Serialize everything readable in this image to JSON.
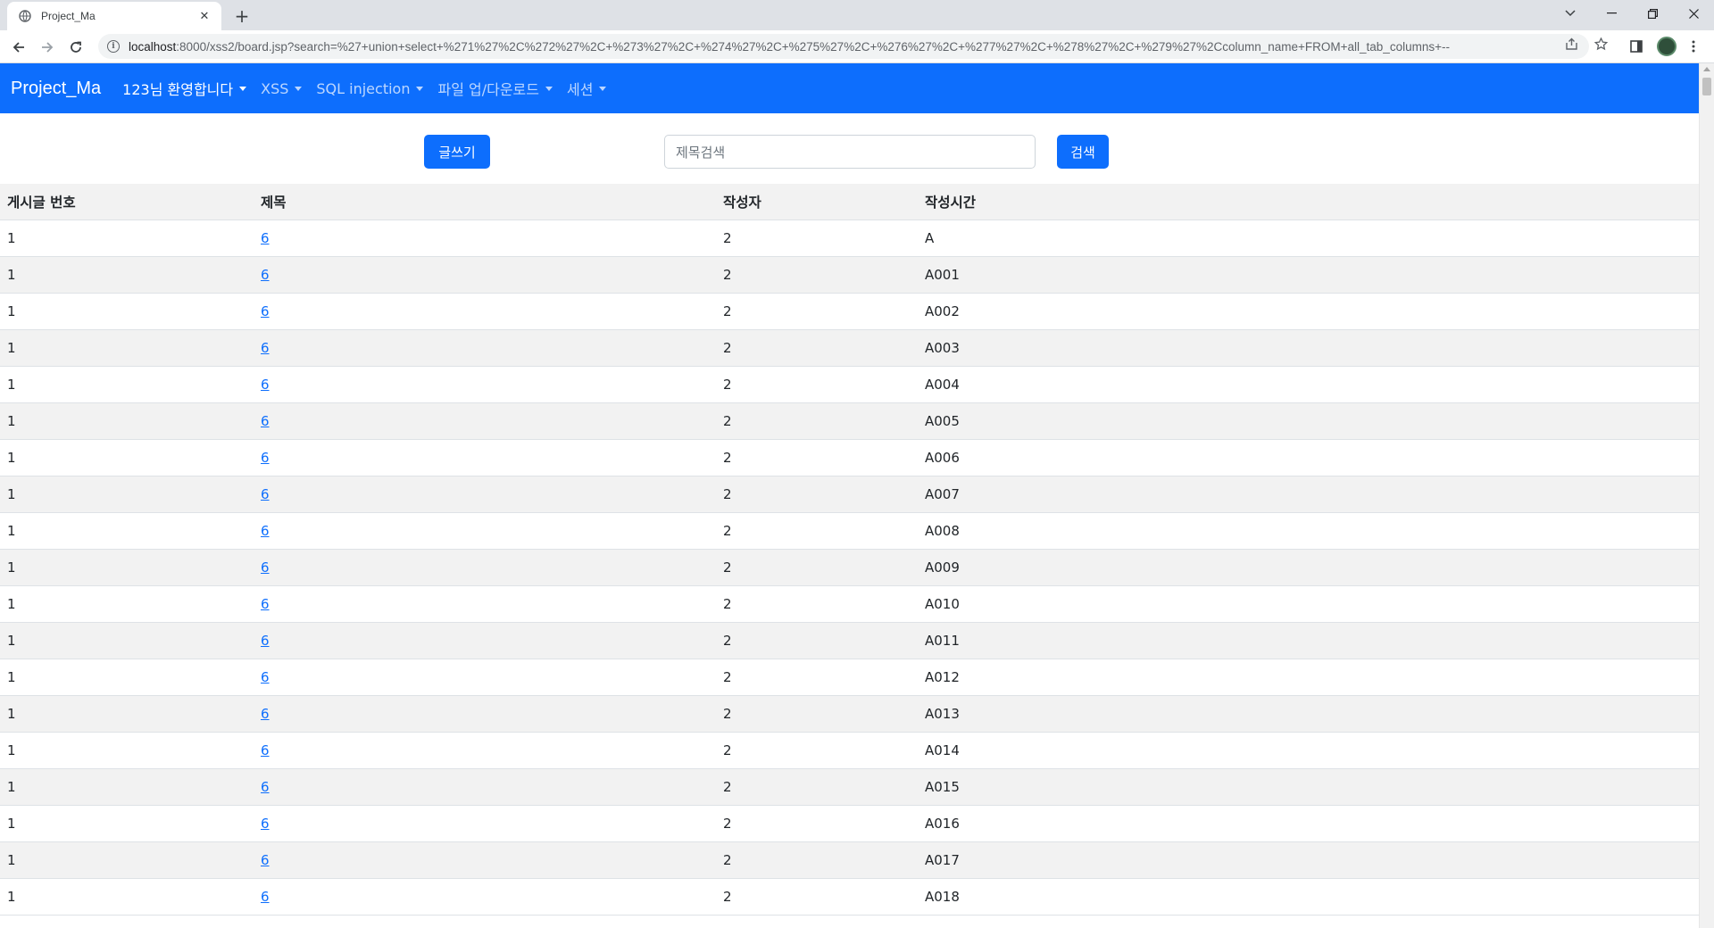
{
  "browser": {
    "tab_title": "Project_Ma",
    "new_tab": "+",
    "url_host": "localhost",
    "url_rest": ":8000/xss2/board.jsp?search=%27+union+select+%271%27%2C%272%27%2C+%273%27%2C+%274%27%2C+%275%27%2C+%276%27%2C+%277%27%2C+%278%27%2C+%279%27%2Ccolumn_name+FROM+all_tab_columns+--"
  },
  "navbar": {
    "brand": "Project_Ma",
    "items": [
      {
        "label": "123님 환영합니다"
      },
      {
        "label": "XSS"
      },
      {
        "label": "SQL injection"
      },
      {
        "label": "파일 업/다운로드"
      },
      {
        "label": "세션"
      }
    ]
  },
  "board": {
    "write_button": "글쓰기",
    "search_placeholder": "제목검색",
    "search_button": "검색",
    "columns": [
      "게시글 번호",
      "제목",
      "작성자",
      "작성시간"
    ],
    "rows": [
      {
        "no": "1",
        "title": "6",
        "author": "2",
        "time": "A"
      },
      {
        "no": "1",
        "title": "6",
        "author": "2",
        "time": "A001"
      },
      {
        "no": "1",
        "title": "6",
        "author": "2",
        "time": "A002"
      },
      {
        "no": "1",
        "title": "6",
        "author": "2",
        "time": "A003"
      },
      {
        "no": "1",
        "title": "6",
        "author": "2",
        "time": "A004"
      },
      {
        "no": "1",
        "title": "6",
        "author": "2",
        "time": "A005"
      },
      {
        "no": "1",
        "title": "6",
        "author": "2",
        "time": "A006"
      },
      {
        "no": "1",
        "title": "6",
        "author": "2",
        "time": "A007"
      },
      {
        "no": "1",
        "title": "6",
        "author": "2",
        "time": "A008"
      },
      {
        "no": "1",
        "title": "6",
        "author": "2",
        "time": "A009"
      },
      {
        "no": "1",
        "title": "6",
        "author": "2",
        "time": "A010"
      },
      {
        "no": "1",
        "title": "6",
        "author": "2",
        "time": "A011"
      },
      {
        "no": "1",
        "title": "6",
        "author": "2",
        "time": "A012"
      },
      {
        "no": "1",
        "title": "6",
        "author": "2",
        "time": "A013"
      },
      {
        "no": "1",
        "title": "6",
        "author": "2",
        "time": "A014"
      },
      {
        "no": "1",
        "title": "6",
        "author": "2",
        "time": "A015"
      },
      {
        "no": "1",
        "title": "6",
        "author": "2",
        "time": "A016"
      },
      {
        "no": "1",
        "title": "6",
        "author": "2",
        "time": "A017"
      },
      {
        "no": "1",
        "title": "6",
        "author": "2",
        "time": "A018"
      }
    ]
  },
  "colors": {
    "navbar": "#0d6efd",
    "primary_button": "#0d6efd",
    "link": "#0d6efd",
    "row_stripe": "#f2f2f2"
  }
}
